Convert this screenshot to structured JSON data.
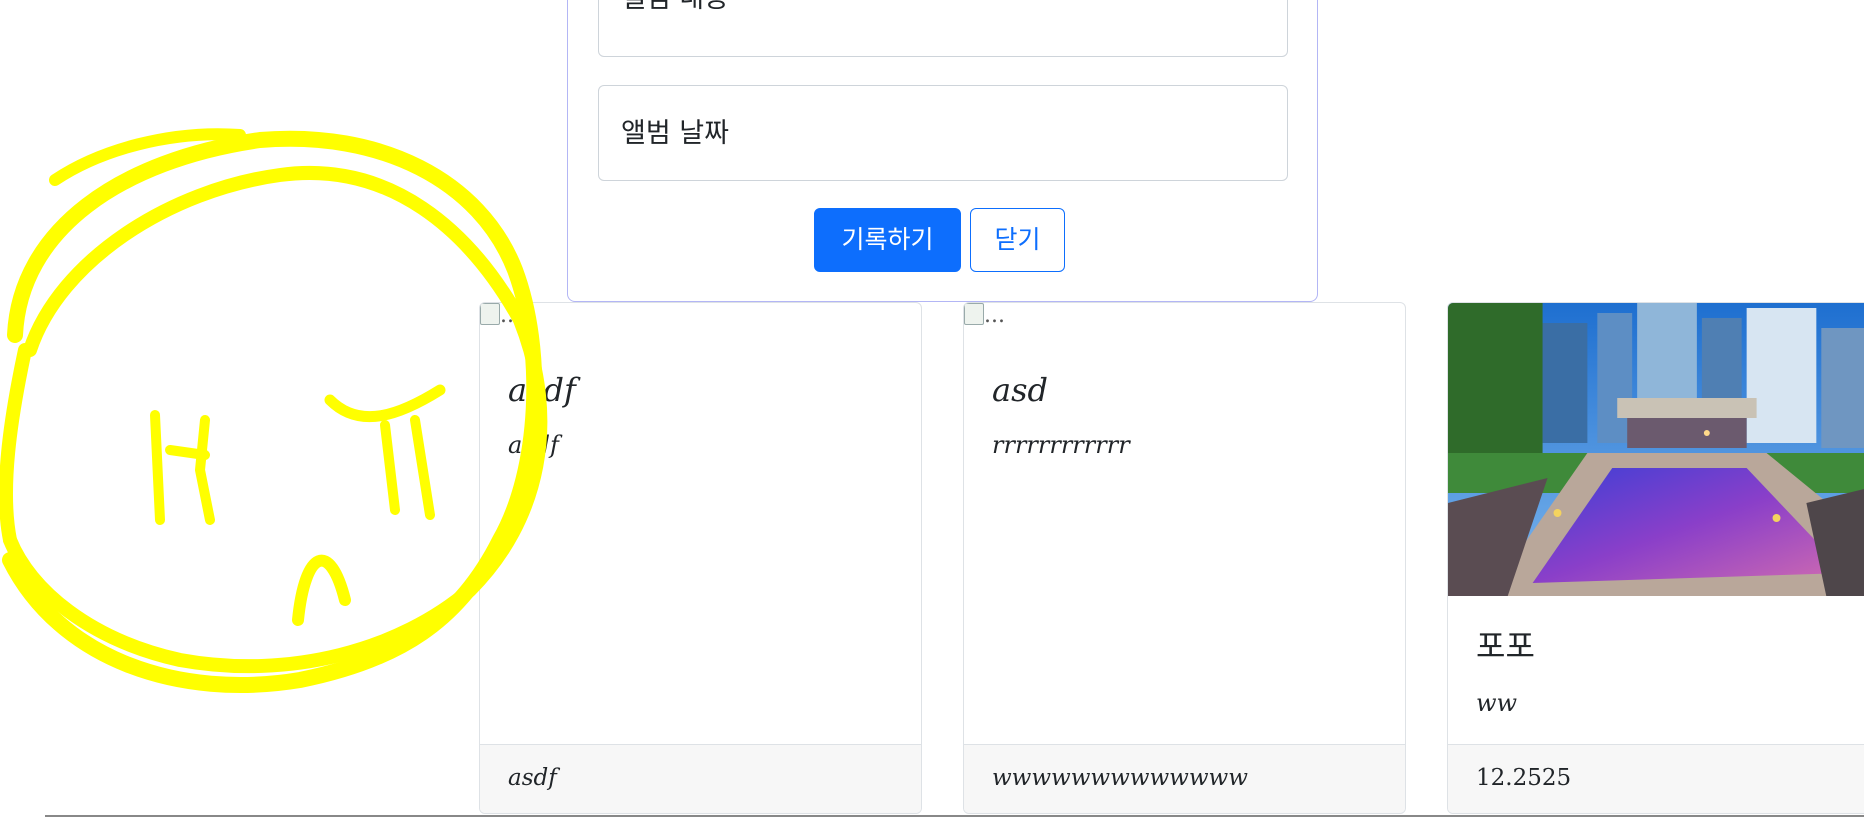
{
  "form": {
    "content_placeholder": "앨범 내용",
    "date_placeholder": "앨범 날짜",
    "submit_label": "기록하기",
    "close_label": "닫기"
  },
  "cards": [
    {
      "img_alt": "...",
      "title": "asdf",
      "text": "asdf",
      "footer": "asdf"
    },
    {
      "img_alt": "...",
      "title": "asd",
      "text": "rrrrrrrrrrrr",
      "footer": "wwwwwwwwwwwww"
    },
    {
      "title": "포포",
      "text": "ww",
      "footer": "12.2525"
    }
  ],
  "colors": {
    "primary": "#0d6efd",
    "scribble": "#ffff00"
  }
}
